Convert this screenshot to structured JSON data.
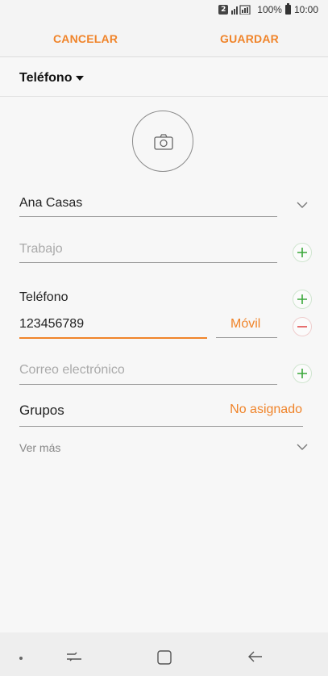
{
  "status_bar": {
    "sim": "2",
    "battery": "100%",
    "time": "10:00",
    "icons": [
      "sim-badge-icon",
      "signal-icon",
      "battery-icon"
    ]
  },
  "top_bar": {
    "cancel_label": "CANCELAR",
    "save_label": "GUARDAR",
    "accent_color": "#f0842a"
  },
  "account": {
    "label": "Teléfono"
  },
  "form": {
    "name_value": "Ana Casas",
    "work_placeholder": "Trabajo",
    "phone_section_label": "Teléfono",
    "phone_value": "123456789",
    "phone_type": "Móvil",
    "email_placeholder": "Correo electrónico",
    "groups_label": "Grupos",
    "groups_value": "No asignado",
    "more_label": "Ver más"
  },
  "nav_bar": {
    "icons": [
      "dot-icon",
      "recent-apps-icon",
      "home-icon",
      "back-icon"
    ]
  }
}
